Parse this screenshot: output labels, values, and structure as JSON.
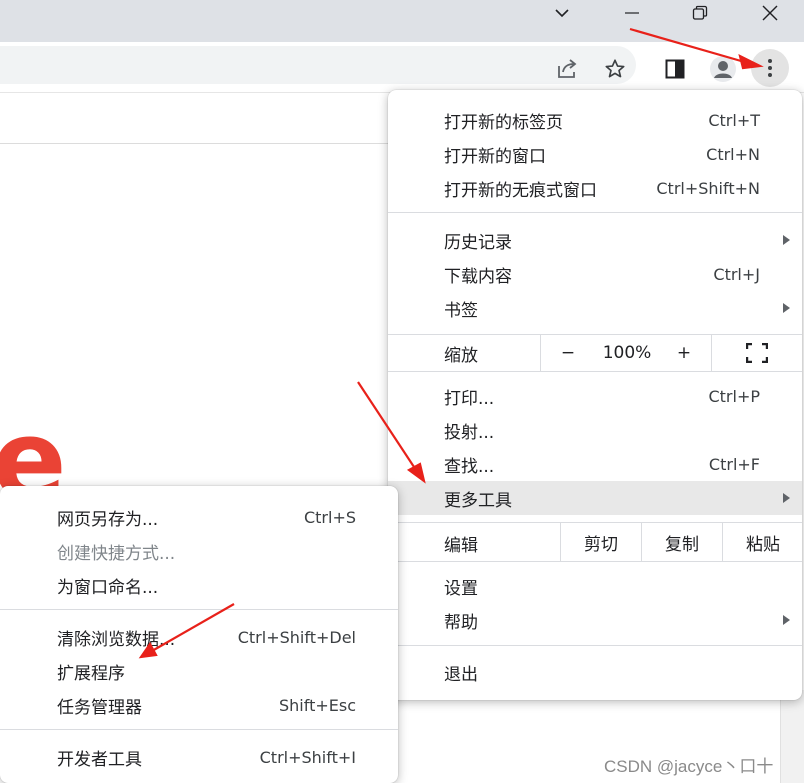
{
  "window_controls": {
    "tabsearch_icon": "chevron-down-icon",
    "minimize_icon": "minimize-icon",
    "restore_icon": "restore-icon",
    "close_icon": "close-icon"
  },
  "toolbar": {
    "share_icon": "share-icon",
    "bookmark_icon": "star-icon",
    "sidepanel_icon": "side-panel-icon",
    "profile_icon": "profile-icon",
    "menu_icon": "three-dots-icon"
  },
  "page": {
    "partial_logo_letter": "e"
  },
  "main_menu": {
    "group1": [
      {
        "label": "打开新的标签页",
        "shortcut": "Ctrl+T"
      },
      {
        "label": "打开新的窗口",
        "shortcut": "Ctrl+N"
      },
      {
        "label": "打开新的无痕式窗口",
        "shortcut": "Ctrl+Shift+N"
      }
    ],
    "group2": [
      {
        "label": "历史记录",
        "shortcut": ""
      },
      {
        "label": "下载内容",
        "shortcut": "Ctrl+J"
      },
      {
        "label": "书签",
        "shortcut": ""
      }
    ],
    "zoom": {
      "label": "缩放",
      "minus": "−",
      "value": "100%",
      "plus": "+"
    },
    "group3": [
      {
        "label": "打印...",
        "shortcut": "Ctrl+P"
      },
      {
        "label": "投射...",
        "shortcut": ""
      },
      {
        "label": "查找...",
        "shortcut": "Ctrl+F"
      },
      {
        "label": "更多工具",
        "shortcut": ""
      }
    ],
    "edit": {
      "label": "编辑",
      "cut": "剪切",
      "copy": "复制",
      "paste": "粘贴"
    },
    "group4": [
      {
        "label": "设置"
      },
      {
        "label": "帮助"
      }
    ],
    "exit": {
      "label": "退出"
    }
  },
  "more_tools_menu": {
    "group1": [
      {
        "label": "网页另存为...",
        "shortcut": "Ctrl+S"
      },
      {
        "label": "创建快捷方式...",
        "shortcut": ""
      },
      {
        "label": "为窗口命名...",
        "shortcut": ""
      }
    ],
    "group2": [
      {
        "label": "清除浏览数据...",
        "shortcut": "Ctrl+Shift+Del"
      },
      {
        "label": "扩展程序",
        "shortcut": ""
      },
      {
        "label": "任务管理器",
        "shortcut": "Shift+Esc"
      }
    ],
    "group3": [
      {
        "label": "开发者工具",
        "shortcut": "Ctrl+Shift+I"
      }
    ]
  },
  "watermark": "CSDN @jacyce丶口十",
  "colors": {
    "annotation_arrow": "#e8211a",
    "logo_red": "#ea4335",
    "highlight": "#e8e8e8"
  }
}
